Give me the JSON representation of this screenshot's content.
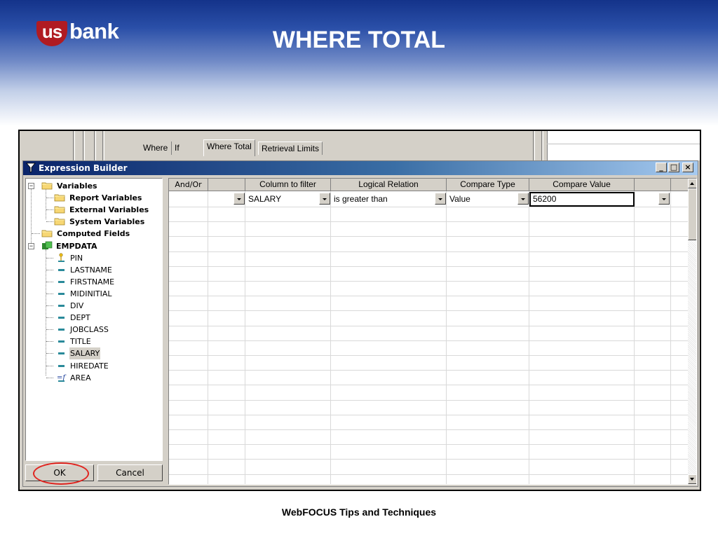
{
  "slide": {
    "title": "WHERE TOTAL",
    "footer": "WebFOCUS Tips and Techniques",
    "logo": {
      "us": "us",
      "bank": "bank"
    }
  },
  "background_window": {
    "tabs": [
      "Where",
      "If",
      "Where Total",
      "Retrieval Limits"
    ],
    "active_tab": "Where Total"
  },
  "dialog": {
    "title": "Expression Builder",
    "caption_buttons": [
      "_",
      "□",
      "×"
    ],
    "ok_label": "OK",
    "cancel_label": "Cancel"
  },
  "tree": {
    "nodes": [
      {
        "label": "Variables",
        "icon": "folder-icon",
        "bold": true
      },
      {
        "label": "Report Variables",
        "icon": "folder-icon",
        "bold": true
      },
      {
        "label": "External Variables",
        "icon": "folder-icon",
        "bold": true
      },
      {
        "label": "System Variables",
        "icon": "folder-icon",
        "bold": true
      },
      {
        "label": "Computed Fields",
        "icon": "folder-icon",
        "bold": true
      },
      {
        "label": "EMPDATA",
        "icon": "database-icon",
        "bold": true
      },
      {
        "label": "PIN",
        "icon": "key-field-icon",
        "bold": false
      },
      {
        "label": "LASTNAME",
        "icon": "field-icon",
        "bold": false
      },
      {
        "label": "FIRSTNAME",
        "icon": "field-icon",
        "bold": false
      },
      {
        "label": "MIDINITIAL",
        "icon": "field-icon",
        "bold": false
      },
      {
        "label": "DIV",
        "icon": "field-icon",
        "bold": false
      },
      {
        "label": "DEPT",
        "icon": "field-icon",
        "bold": false
      },
      {
        "label": "JOBCLASS",
        "icon": "field-icon",
        "bold": false
      },
      {
        "label": "TITLE",
        "icon": "field-icon",
        "bold": false
      },
      {
        "label": "SALARY",
        "icon": "field-icon",
        "bold": false,
        "selected": true
      },
      {
        "label": "HIREDATE",
        "icon": "field-icon",
        "bold": false
      },
      {
        "label": "AREA",
        "icon": "computed-field-icon",
        "bold": false
      }
    ]
  },
  "grid": {
    "columns": [
      "And/Or",
      "",
      "Column to filter",
      "Logical Relation",
      "Compare Type",
      "Compare Value",
      ""
    ],
    "row1": {
      "column_to_filter": "SALARY",
      "logical_relation": "is greater than",
      "compare_type": "Value",
      "compare_value": "56200"
    }
  },
  "colors": {
    "annotation_circle": "#e0241f",
    "titlebar_start": "#0a246a",
    "brand_red": "#b01b22"
  }
}
